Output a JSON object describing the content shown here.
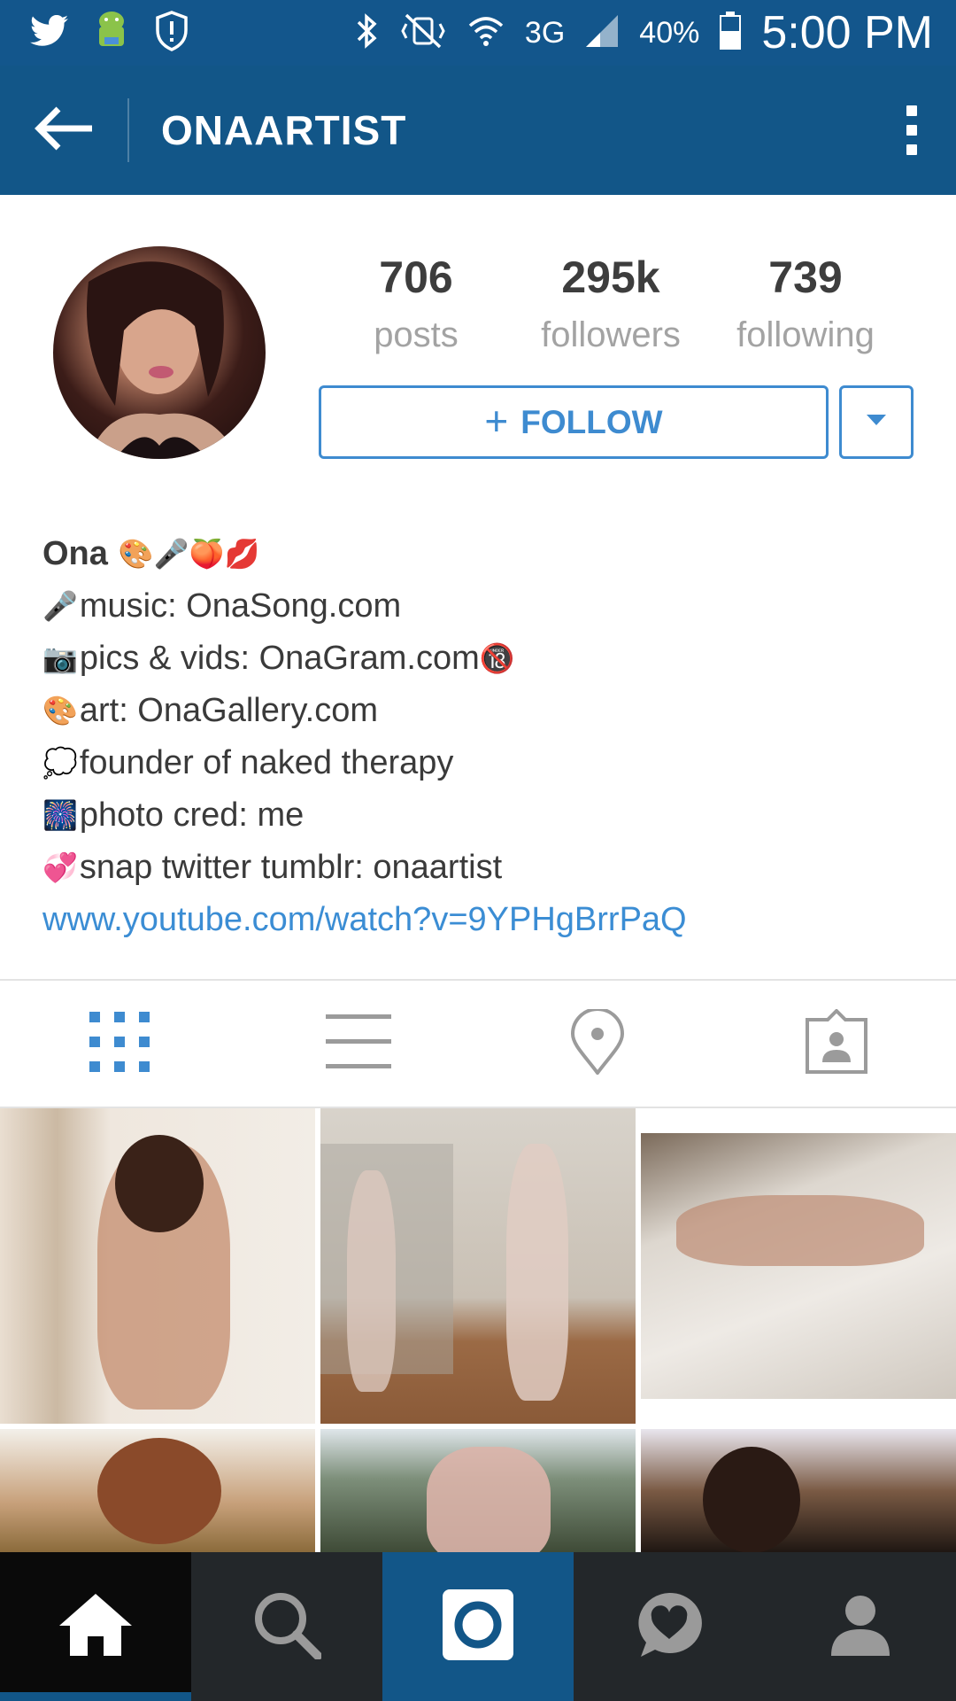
{
  "status_bar": {
    "battery": "40%",
    "time": "5:00 PM",
    "network": "3G"
  },
  "app_bar": {
    "title": "ONAARTIST"
  },
  "profile": {
    "stats": [
      {
        "value": "706",
        "label": "posts"
      },
      {
        "value": "295k",
        "label": "followers"
      },
      {
        "value": "739",
        "label": "following"
      }
    ],
    "follow_label": "FOLLOW",
    "follow_plus": "+"
  },
  "bio": {
    "name": "Ona",
    "name_emojis": "🎨🎤🍑💋",
    "lines": [
      {
        "emoji": "🎤",
        "text": "music: OnaSong.com"
      },
      {
        "emoji": "📷",
        "text": "pics & vids: OnaGram.com",
        "suffix": "🔞"
      },
      {
        "emoji": "🎨",
        "text": "art: OnaGallery.com"
      },
      {
        "emoji": "💭",
        "text": "founder of naked therapy"
      },
      {
        "emoji": "🎆",
        "text": "photo cred: me"
      },
      {
        "emoji": "💞",
        "text": "snap twitter tumblr: onaartist"
      }
    ],
    "link": "www.youtube.com/watch?v=9YPHgBrrPaQ"
  },
  "colors": {
    "app_bar": "#125688",
    "accent": "#3e8bd0",
    "link": "#3b8dd4"
  }
}
